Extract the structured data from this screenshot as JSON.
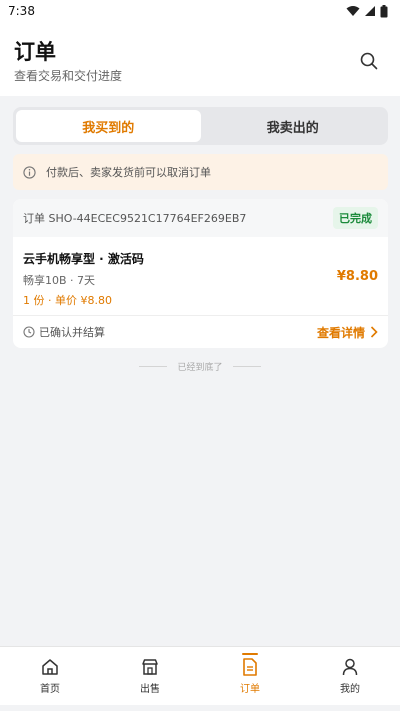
{
  "status_bar": {
    "time": "7:38"
  },
  "header": {
    "title": "订单",
    "subtitle": "查看交易和交付进度",
    "search_icon": "search-icon"
  },
  "tabs": [
    {
      "label": "我买到的",
      "active": true
    },
    {
      "label": "我卖出的",
      "active": false
    }
  ],
  "notice": {
    "text": "付款后、卖家发货前可以取消订单",
    "icon": "info-icon"
  },
  "order": {
    "id_text": "订单 SHO-44ECEC9521C17764EF269EB7",
    "status": "已完成",
    "item_name": "云手机畅享型 · 激活码",
    "item_spec": "畅享10B · 7天",
    "qty_price": "1 份 · 单价 ¥8.80",
    "total_price": "¥8.80",
    "settle_text": "已确认并结算",
    "detail_label": "查看详情"
  },
  "end_text": "已经到底了",
  "bottom_nav": [
    {
      "label": "首页",
      "icon": "home-icon",
      "active": false
    },
    {
      "label": "出售",
      "icon": "store-icon",
      "active": false
    },
    {
      "label": "订单",
      "icon": "document-icon",
      "active": true
    },
    {
      "label": "我的",
      "icon": "user-icon",
      "active": false
    }
  ],
  "colors": {
    "accent": "#e07a00",
    "success": "#1a8a3a",
    "notice_bg": "#fdf2e6",
    "page_bg": "#f2f3f5"
  }
}
